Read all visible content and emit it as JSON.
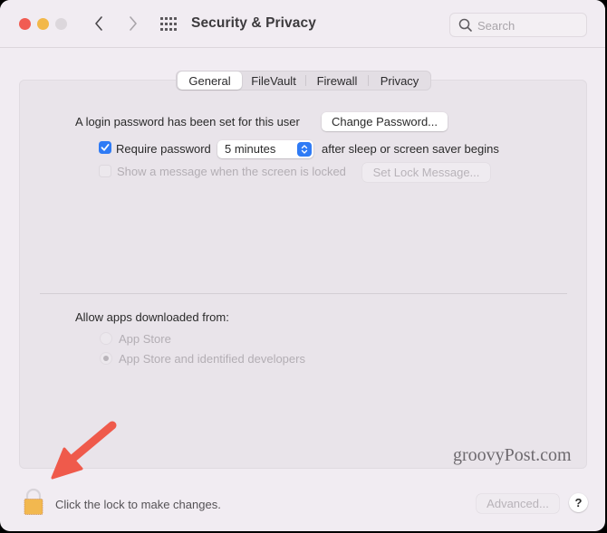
{
  "window": {
    "title": "Security & Privacy",
    "search_placeholder": "Search",
    "search_value": ""
  },
  "tabs": [
    {
      "label": "General",
      "active": true
    },
    {
      "label": "FileVault",
      "active": false
    },
    {
      "label": "Firewall",
      "active": false
    },
    {
      "label": "Privacy",
      "active": false
    }
  ],
  "general": {
    "login_password_text": "A login password has been set for this user",
    "change_password_label": "Change Password...",
    "require_password_label": "Require password",
    "require_password_checked": true,
    "require_password_delay": "5 minutes",
    "after_sleep_text": "after sleep or screen saver begins",
    "show_message_label": "Show a message when the screen is locked",
    "show_message_checked": false,
    "set_lock_message_label": "Set Lock Message...",
    "allow_apps_label": "Allow apps downloaded from:",
    "allow_apps_options": [
      {
        "label": "App Store",
        "selected": false
      },
      {
        "label": "App Store and identified developers",
        "selected": true
      }
    ]
  },
  "footer": {
    "lock_text": "Click the lock to make changes.",
    "advanced_label": "Advanced...",
    "help_label": "?"
  },
  "watermark": "groovyPost.com",
  "colors": {
    "accent": "#2f7bf5",
    "annotation_arrow": "#ef5a4b",
    "lock": "#f2b84f",
    "close": "#f15c53",
    "minimize": "#f2b84a"
  }
}
